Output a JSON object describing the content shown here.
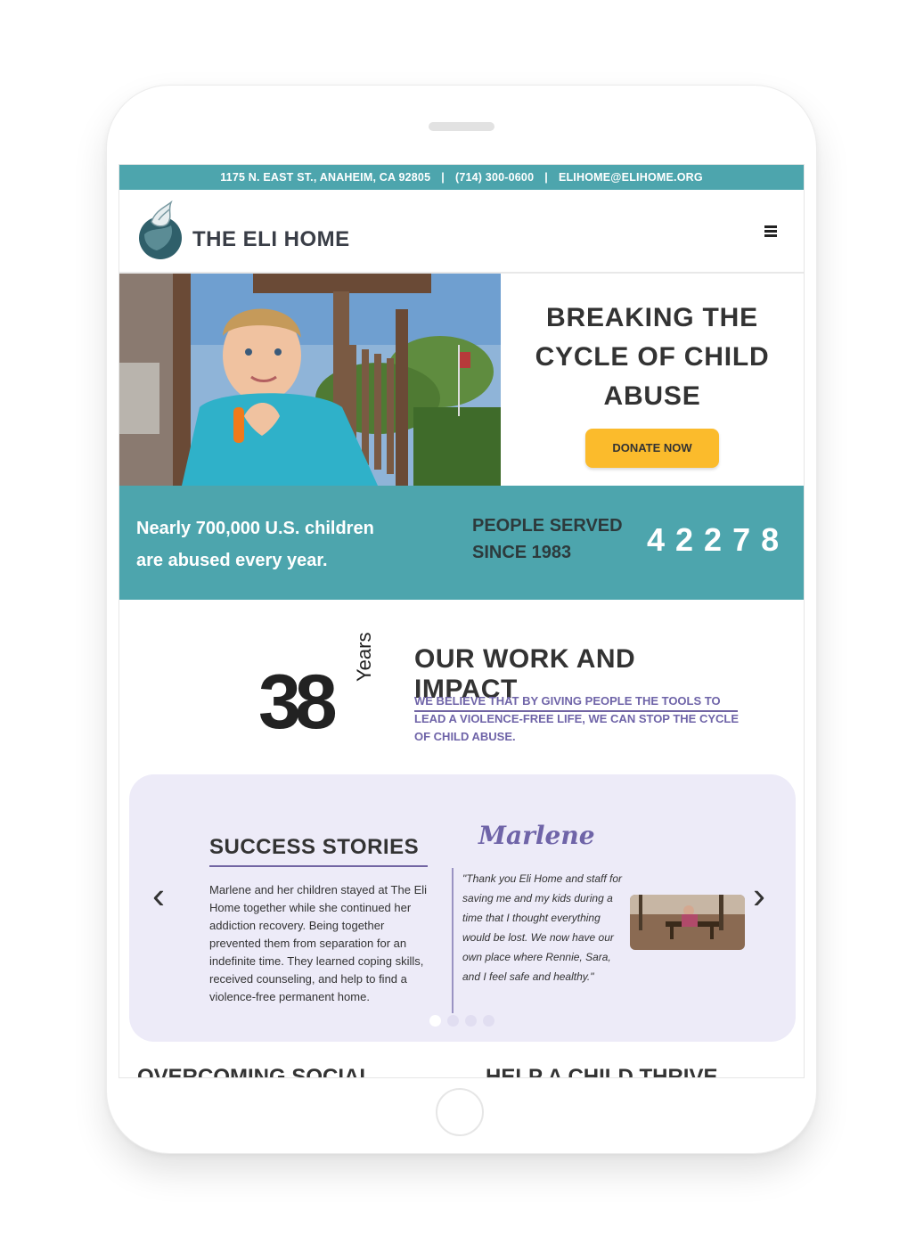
{
  "topbar": {
    "address": "1175 N. EAST ST., ANAHEIM, CA 92805",
    "sep1": "|",
    "phone": "(714) 300-0600",
    "sep2": "|",
    "email": "ELIHOME@ELIHOME.ORG"
  },
  "header": {
    "logo_text": "THE ELI HOME"
  },
  "hero": {
    "title_line1": "BREAKING THE",
    "title_line2": "CYCLE OF CHILD",
    "title_line3": "ABUSE",
    "donate_label": "DONATE NOW"
  },
  "stats": {
    "fact_line1": "Nearly 700,000 U.S. children",
    "fact_line2": "are abused every year.",
    "served_line1": "PEOPLE SERVED",
    "served_line2": "SINCE 1983",
    "served_count": "42278"
  },
  "impact": {
    "years_number": "38",
    "years_label": "Years",
    "title": "OUR WORK AND IMPACT",
    "text": "WE BELIEVE THAT BY GIVING PEOPLE THE TOOLS TO LEAD A VIOLENCE-FREE LIFE, WE CAN STOP THE CYCLE OF CHILD ABUSE."
  },
  "stories": {
    "title": "SUCCESS STORIES",
    "text": "Marlene and her children stayed at The Eli Home together while she continued her addiction recovery. Being together prevented them from separation for an indefinite time. They learned coping skills, received counseling, and help to find a violence-free permanent home.",
    "signature": "Marlene",
    "quote": "\"Thank you Eli Home and staff for saving me and my kids during a time that I thought everything would be lost. We now have our own place where Rennie, Sara, and I feel safe and healthy.\"",
    "prev_icon": "chevron-left-icon",
    "next_icon": "chevron-right-icon"
  },
  "bottom": {
    "left_heading": "OVERCOMING SOCIAL",
    "right_heading": "HELP A CHILD THRIVE"
  },
  "colors": {
    "teal": "#4da5ad",
    "purple": "#6f64a8",
    "yellow": "#fbbb2c",
    "lavender": "#edebf8"
  }
}
